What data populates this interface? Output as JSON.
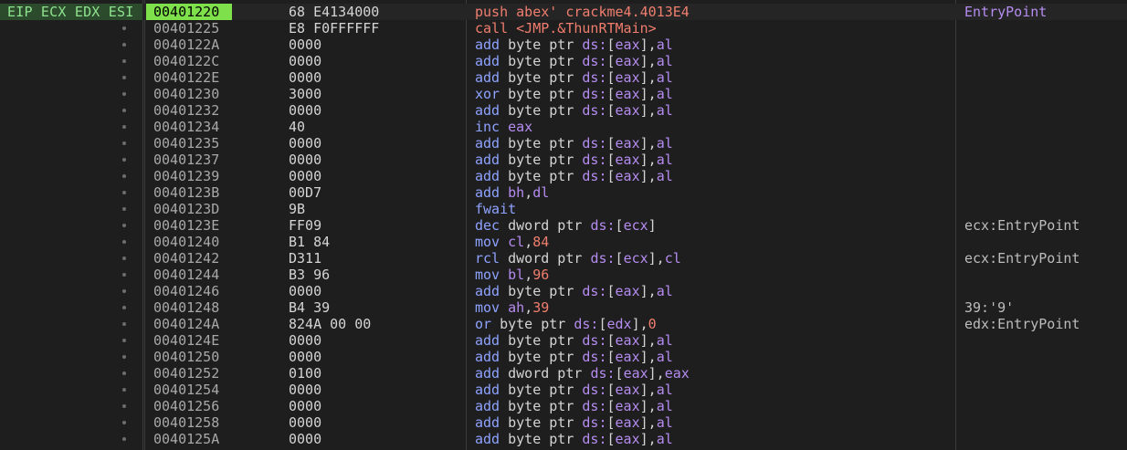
{
  "register_label": "EIP ECX EDX ESI",
  "rows": [
    {
      "addr": "00401220",
      "bytes": "68 E4134000",
      "dis": [
        [
          "mn-red",
          "push"
        ],
        [
          "pl",
          " "
        ],
        [
          "lab",
          "abex' crackme4.4013E4"
        ]
      ],
      "comment": "EntryPoint",
      "comment_style": "ep",
      "current": true
    },
    {
      "addr": "00401225",
      "bytes": "E8 F0FFFFFF",
      "dis": [
        [
          "mn-red",
          "call"
        ],
        [
          "pl",
          " "
        ],
        [
          "lab",
          "<JMP.&ThunRTMain>"
        ]
      ],
      "comment": ""
    },
    {
      "addr": "0040122A",
      "bytes": "0000",
      "dis": [
        [
          "mn",
          "add"
        ],
        [
          "pl",
          " "
        ],
        [
          "sz",
          "byte ptr "
        ],
        [
          "seg",
          "ds:"
        ],
        [
          "pl",
          "["
        ],
        [
          "reg",
          "eax"
        ],
        [
          "pl",
          "],"
        ],
        [
          "reg",
          "al"
        ]
      ],
      "comment": ""
    },
    {
      "addr": "0040122C",
      "bytes": "0000",
      "dis": [
        [
          "mn",
          "add"
        ],
        [
          "pl",
          " "
        ],
        [
          "sz",
          "byte ptr "
        ],
        [
          "seg",
          "ds:"
        ],
        [
          "pl",
          "["
        ],
        [
          "reg",
          "eax"
        ],
        [
          "pl",
          "],"
        ],
        [
          "reg",
          "al"
        ]
      ],
      "comment": ""
    },
    {
      "addr": "0040122E",
      "bytes": "0000",
      "dis": [
        [
          "mn",
          "add"
        ],
        [
          "pl",
          " "
        ],
        [
          "sz",
          "byte ptr "
        ],
        [
          "seg",
          "ds:"
        ],
        [
          "pl",
          "["
        ],
        [
          "reg",
          "eax"
        ],
        [
          "pl",
          "],"
        ],
        [
          "reg",
          "al"
        ]
      ],
      "comment": ""
    },
    {
      "addr": "00401230",
      "bytes": "3000",
      "dis": [
        [
          "mn",
          "xor"
        ],
        [
          "pl",
          " "
        ],
        [
          "sz",
          "byte ptr "
        ],
        [
          "seg",
          "ds:"
        ],
        [
          "pl",
          "["
        ],
        [
          "reg",
          "eax"
        ],
        [
          "pl",
          "],"
        ],
        [
          "reg",
          "al"
        ]
      ],
      "comment": ""
    },
    {
      "addr": "00401232",
      "bytes": "0000",
      "dis": [
        [
          "mn",
          "add"
        ],
        [
          "pl",
          " "
        ],
        [
          "sz",
          "byte ptr "
        ],
        [
          "seg",
          "ds:"
        ],
        [
          "pl",
          "["
        ],
        [
          "reg",
          "eax"
        ],
        [
          "pl",
          "],"
        ],
        [
          "reg",
          "al"
        ]
      ],
      "comment": ""
    },
    {
      "addr": "00401234",
      "bytes": "40",
      "dis": [
        [
          "mn",
          "inc"
        ],
        [
          "pl",
          " "
        ],
        [
          "reg",
          "eax"
        ]
      ],
      "comment": ""
    },
    {
      "addr": "00401235",
      "bytes": "0000",
      "dis": [
        [
          "mn",
          "add"
        ],
        [
          "pl",
          " "
        ],
        [
          "sz",
          "byte ptr "
        ],
        [
          "seg",
          "ds:"
        ],
        [
          "pl",
          "["
        ],
        [
          "reg",
          "eax"
        ],
        [
          "pl",
          "],"
        ],
        [
          "reg",
          "al"
        ]
      ],
      "comment": ""
    },
    {
      "addr": "00401237",
      "bytes": "0000",
      "dis": [
        [
          "mn",
          "add"
        ],
        [
          "pl",
          " "
        ],
        [
          "sz",
          "byte ptr "
        ],
        [
          "seg",
          "ds:"
        ],
        [
          "pl",
          "["
        ],
        [
          "reg",
          "eax"
        ],
        [
          "pl",
          "],"
        ],
        [
          "reg",
          "al"
        ]
      ],
      "comment": ""
    },
    {
      "addr": "00401239",
      "bytes": "0000",
      "dis": [
        [
          "mn",
          "add"
        ],
        [
          "pl",
          " "
        ],
        [
          "sz",
          "byte ptr "
        ],
        [
          "seg",
          "ds:"
        ],
        [
          "pl",
          "["
        ],
        [
          "reg",
          "eax"
        ],
        [
          "pl",
          "],"
        ],
        [
          "reg",
          "al"
        ]
      ],
      "comment": ""
    },
    {
      "addr": "0040123B",
      "bytes": "00D7",
      "dis": [
        [
          "mn",
          "add"
        ],
        [
          "pl",
          " "
        ],
        [
          "reg",
          "bh"
        ],
        [
          "pl",
          ","
        ],
        [
          "reg",
          "dl"
        ]
      ],
      "comment": ""
    },
    {
      "addr": "0040123D",
      "bytes": "9B",
      "dis": [
        [
          "mn",
          "fwait"
        ]
      ],
      "comment": ""
    },
    {
      "addr": "0040123E",
      "bytes": "FF09",
      "dis": [
        [
          "mn",
          "dec"
        ],
        [
          "pl",
          " "
        ],
        [
          "sz",
          "dword ptr "
        ],
        [
          "seg",
          "ds:"
        ],
        [
          "pl",
          "["
        ],
        [
          "reg",
          "ecx"
        ],
        [
          "pl",
          "]"
        ]
      ],
      "comment": "ecx:EntryPoint"
    },
    {
      "addr": "00401240",
      "bytes": "B1 84",
      "dis": [
        [
          "mn",
          "mov"
        ],
        [
          "pl",
          " "
        ],
        [
          "reg",
          "cl"
        ],
        [
          "pl",
          ","
        ],
        [
          "num",
          "84"
        ]
      ],
      "comment": ""
    },
    {
      "addr": "00401242",
      "bytes": "D311",
      "dis": [
        [
          "mn",
          "rcl"
        ],
        [
          "pl",
          " "
        ],
        [
          "sz",
          "dword ptr "
        ],
        [
          "seg",
          "ds:"
        ],
        [
          "pl",
          "["
        ],
        [
          "reg",
          "ecx"
        ],
        [
          "pl",
          "],"
        ],
        [
          "reg",
          "cl"
        ]
      ],
      "comment": "ecx:EntryPoint"
    },
    {
      "addr": "00401244",
      "bytes": "B3 96",
      "dis": [
        [
          "mn",
          "mov"
        ],
        [
          "pl",
          " "
        ],
        [
          "reg",
          "bl"
        ],
        [
          "pl",
          ","
        ],
        [
          "num",
          "96"
        ]
      ],
      "comment": ""
    },
    {
      "addr": "00401246",
      "bytes": "0000",
      "dis": [
        [
          "mn",
          "add"
        ],
        [
          "pl",
          " "
        ],
        [
          "sz",
          "byte ptr "
        ],
        [
          "seg",
          "ds:"
        ],
        [
          "pl",
          "["
        ],
        [
          "reg",
          "eax"
        ],
        [
          "pl",
          "],"
        ],
        [
          "reg",
          "al"
        ]
      ],
      "comment": ""
    },
    {
      "addr": "00401248",
      "bytes": "B4 39",
      "dis": [
        [
          "mn",
          "mov"
        ],
        [
          "pl",
          " "
        ],
        [
          "reg",
          "ah"
        ],
        [
          "pl",
          ","
        ],
        [
          "num",
          "39"
        ]
      ],
      "comment": "39:'9'"
    },
    {
      "addr": "0040124A",
      "bytes": "824A 00 00",
      "dis": [
        [
          "mn",
          "or"
        ],
        [
          "pl",
          " "
        ],
        [
          "sz",
          "byte ptr "
        ],
        [
          "seg",
          "ds:"
        ],
        [
          "pl",
          "["
        ],
        [
          "reg",
          "edx"
        ],
        [
          "pl",
          "],"
        ],
        [
          "num",
          "0"
        ]
      ],
      "comment": "edx:EntryPoint"
    },
    {
      "addr": "0040124E",
      "bytes": "0000",
      "dis": [
        [
          "mn",
          "add"
        ],
        [
          "pl",
          " "
        ],
        [
          "sz",
          "byte ptr "
        ],
        [
          "seg",
          "ds:"
        ],
        [
          "pl",
          "["
        ],
        [
          "reg",
          "eax"
        ],
        [
          "pl",
          "],"
        ],
        [
          "reg",
          "al"
        ]
      ],
      "comment": ""
    },
    {
      "addr": "00401250",
      "bytes": "0000",
      "dis": [
        [
          "mn",
          "add"
        ],
        [
          "pl",
          " "
        ],
        [
          "sz",
          "byte ptr "
        ],
        [
          "seg",
          "ds:"
        ],
        [
          "pl",
          "["
        ],
        [
          "reg",
          "eax"
        ],
        [
          "pl",
          "],"
        ],
        [
          "reg",
          "al"
        ]
      ],
      "comment": ""
    },
    {
      "addr": "00401252",
      "bytes": "0100",
      "dis": [
        [
          "mn",
          "add"
        ],
        [
          "pl",
          " "
        ],
        [
          "sz",
          "dword ptr "
        ],
        [
          "seg",
          "ds:"
        ],
        [
          "pl",
          "["
        ],
        [
          "reg",
          "eax"
        ],
        [
          "pl",
          "],"
        ],
        [
          "reg",
          "eax"
        ]
      ],
      "comment": ""
    },
    {
      "addr": "00401254",
      "bytes": "0000",
      "dis": [
        [
          "mn",
          "add"
        ],
        [
          "pl",
          " "
        ],
        [
          "sz",
          "byte ptr "
        ],
        [
          "seg",
          "ds:"
        ],
        [
          "pl",
          "["
        ],
        [
          "reg",
          "eax"
        ],
        [
          "pl",
          "],"
        ],
        [
          "reg",
          "al"
        ]
      ],
      "comment": ""
    },
    {
      "addr": "00401256",
      "bytes": "0000",
      "dis": [
        [
          "mn",
          "add"
        ],
        [
          "pl",
          " "
        ],
        [
          "sz",
          "byte ptr "
        ],
        [
          "seg",
          "ds:"
        ],
        [
          "pl",
          "["
        ],
        [
          "reg",
          "eax"
        ],
        [
          "pl",
          "],"
        ],
        [
          "reg",
          "al"
        ]
      ],
      "comment": ""
    },
    {
      "addr": "00401258",
      "bytes": "0000",
      "dis": [
        [
          "mn",
          "add"
        ],
        [
          "pl",
          " "
        ],
        [
          "sz",
          "byte ptr "
        ],
        [
          "seg",
          "ds:"
        ],
        [
          "pl",
          "["
        ],
        [
          "reg",
          "eax"
        ],
        [
          "pl",
          "],"
        ],
        [
          "reg",
          "al"
        ]
      ],
      "comment": ""
    },
    {
      "addr": "0040125A",
      "bytes": "0000",
      "dis": [
        [
          "mn",
          "add"
        ],
        [
          "pl",
          " "
        ],
        [
          "sz",
          "byte ptr "
        ],
        [
          "seg",
          "ds:"
        ],
        [
          "pl",
          "["
        ],
        [
          "reg",
          "eax"
        ],
        [
          "pl",
          "],"
        ],
        [
          "reg",
          "al"
        ]
      ],
      "comment": ""
    }
  ],
  "colors": {
    "background": "#1e1e1e",
    "eip_highlight": "#7ee04a",
    "register_label_bg": "#2c4a2c",
    "mnemonic": "#8ea2ff",
    "call_push": "#f07e6e",
    "immediate": "#f07e6e",
    "register": "#b58cf0",
    "segment": "#b58cf0",
    "entrypoint_comment": "#b58cf0"
  },
  "icons": {
    "breakpoint_marker": "bullet-dot-icon"
  }
}
